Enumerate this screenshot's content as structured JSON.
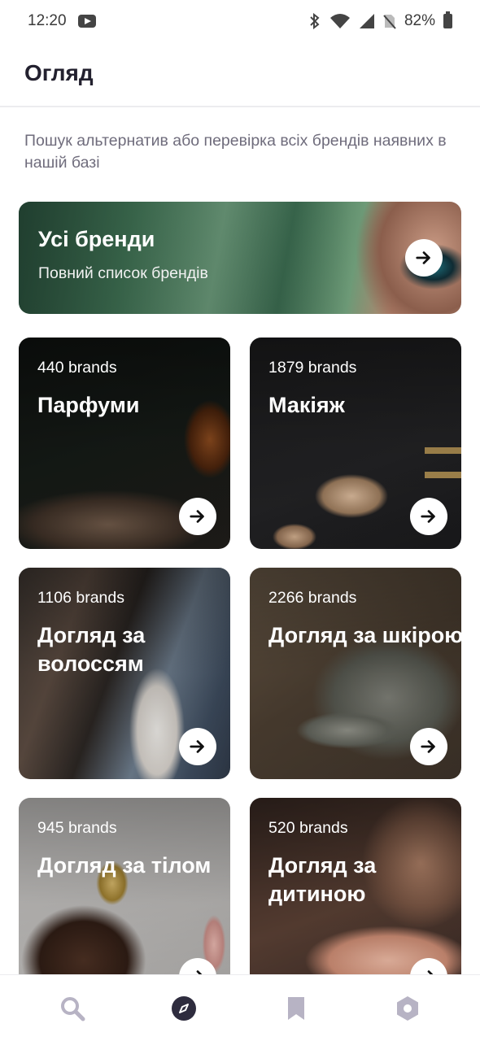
{
  "status_bar": {
    "time": "12:20",
    "battery": "82%",
    "icons": [
      "youtube-icon",
      "bluetooth-icon",
      "wifi-icon",
      "signal-icon",
      "no-sim-icon",
      "battery-icon"
    ]
  },
  "header": {
    "title": "Огляд"
  },
  "intro": "Пошук альтернатив або перевірка всіх брендів наявних в нашій базі",
  "all_brands": {
    "title": "Усі бренди",
    "subtitle": "Повний список брендів"
  },
  "categories": [
    {
      "count": "440 brands",
      "title": "Парфуми"
    },
    {
      "count": "1879 brands",
      "title": "Макіяж"
    },
    {
      "count": "1106 brands",
      "title": "Догляд за волоссям"
    },
    {
      "count": "2266 brands",
      "title": "Догляд за шкірою"
    },
    {
      "count": "945 brands",
      "title": "Догляд за тілом"
    },
    {
      "count": "520 brands",
      "title": "Догляд за дитиною"
    }
  ],
  "bottom_nav": {
    "items": [
      "search-icon",
      "compass-icon",
      "bookmark-icon",
      "settings-icon"
    ],
    "active_index": 1
  },
  "colors": {
    "accent": "#2e2c3e",
    "inactive_nav": "#b7b3c4",
    "intro_text": "#6f6c7c"
  }
}
